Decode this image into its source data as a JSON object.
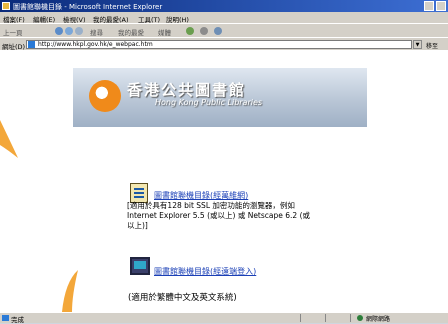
{
  "window": {
    "title": "圖書館聯機目錄 - Microsoft Internet Explorer"
  },
  "menu": [
    "檔案(F)",
    "編輯(E)",
    "檢視(V)",
    "我的最愛(A)",
    "工具(T)",
    "說明(H)"
  ],
  "toolbar": {
    "back": "上一頁",
    "search": "搜尋",
    "favorites": "我的最愛",
    "media": "媒體"
  },
  "address": {
    "label": "網址(D)",
    "url": "http://www.hkpl.gov.hk/e_webpac.htm",
    "go": "移至"
  },
  "banner": {
    "title_cn": "香港公共圖書館",
    "title_en": "Hong Kong Public Libraries"
  },
  "links": {
    "web_catalog": "圖書館聯機目錄(經萬維網)",
    "web_catalog_desc": "[適用於具有128 bit SSL 加密功能的瀏覽器，例如 Internet Explorer 5.5 (或以上) 或 Netscape 6.2 (或以上)]",
    "telnet_catalog": "圖書館聯機目錄(經遠端登入)",
    "telnet_catalog_desc": "(適用於繁體中文及英文系統)"
  },
  "status": {
    "text": "完成",
    "zone": "網際網路"
  }
}
